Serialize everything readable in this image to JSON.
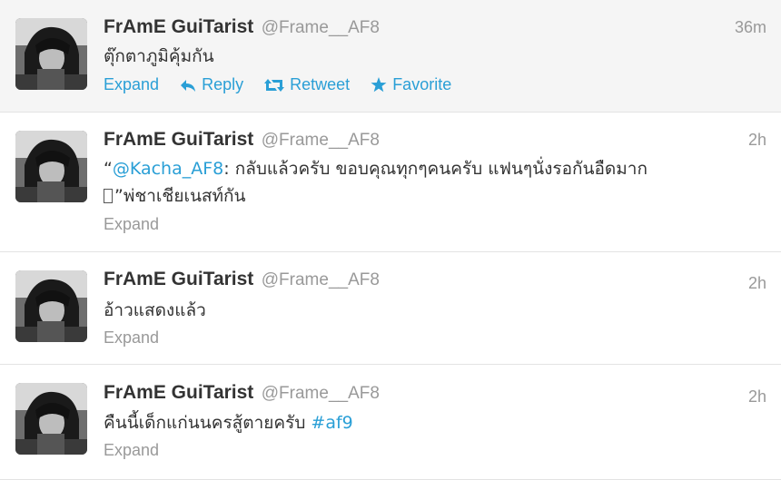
{
  "tweets": [
    {
      "fullname": "FrAmE GuiTarist",
      "username": "@Frame__AF8",
      "time": "36m",
      "text": "ตุ๊กตาภูมิคุ้มกัน",
      "actions": {
        "expand": "Expand",
        "reply": "Reply",
        "retweet": "Retweet",
        "favorite": "Favorite"
      }
    },
    {
      "fullname": "FrAmE GuiTarist",
      "username": "@Frame__AF8",
      "time": "2h",
      "quote_open": "“",
      "mention": "@Kacha_AF8",
      "line1_rest": ": กลับแล้วครับ ขอบคุณทุกๆคนครับ แฟนๆนั่งรอกันอืดมาก",
      "line2": "”พ่ชาเชียเนสท์กัน",
      "expand": "Expand"
    },
    {
      "fullname": "FrAmE GuiTarist",
      "username": "@Frame__AF8",
      "time": "2h",
      "text": "อ้าวแสดงแล้ว",
      "expand": "Expand"
    },
    {
      "fullname": "FrAmE GuiTarist",
      "username": "@Frame__AF8",
      "time": "2h",
      "text": "คืนนี้เด็กแก่นนครสู้ตายครับ ",
      "hashtag": "#af9",
      "expand": "Expand"
    }
  ],
  "colors": {
    "link": "#2a9fd6",
    "muted": "#999999",
    "text": "#333333",
    "hover_bg": "#f5f5f5",
    "divider": "#e3e3e3"
  },
  "icons": {
    "reply": "reply-arrow-icon",
    "retweet": "retweet-arrows-icon",
    "favorite": "star-icon"
  }
}
